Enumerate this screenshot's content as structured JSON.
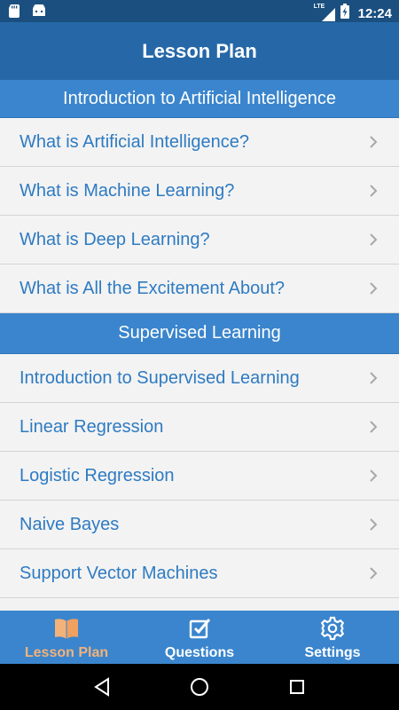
{
  "status_bar": {
    "time": "12:24",
    "network": "LTE",
    "icons": [
      "sd-card-icon",
      "android-icon",
      "lte-signal-icon",
      "battery-charging-icon"
    ]
  },
  "header": {
    "title": "Lesson Plan"
  },
  "sections": [
    {
      "title": "Introduction to Artificial Intelligence",
      "items": [
        "What is Artificial Intelligence?",
        "What is Machine Learning?",
        "What is Deep Learning?",
        "What is All the Excitement About?"
      ]
    },
    {
      "title": "Supervised Learning",
      "items": [
        "Introduction to Supervised Learning",
        "Linear Regression",
        "Logistic Regression",
        "Naive Bayes",
        "Support Vector Machines"
      ]
    }
  ],
  "tabs": [
    {
      "label": "Lesson Plan",
      "icon": "book-icon",
      "active": true
    },
    {
      "label": "Questions",
      "icon": "checkbox-icon",
      "active": false
    },
    {
      "label": "Settings",
      "icon": "gear-icon",
      "active": false
    }
  ],
  "colors": {
    "status_bar": "#1a4f80",
    "title_bar": "#2668a7",
    "section_header": "#3a85cd",
    "item_text": "#2e7bc2",
    "active_tab": "#f3b27a"
  }
}
